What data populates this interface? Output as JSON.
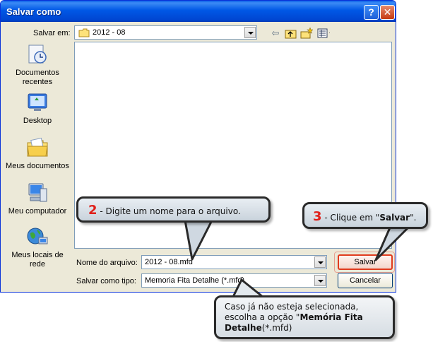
{
  "window": {
    "title": "Salvar como",
    "help_btn": "?",
    "close_btn": "✕"
  },
  "toolbar": {
    "save_in_label": "Salvar em:",
    "save_in_value": "2012 - 08",
    "icons": [
      "back-icon",
      "up-folder-icon",
      "new-folder-icon",
      "view-menu-icon"
    ]
  },
  "places": [
    {
      "label": "Documentos recentes",
      "icon": "recent-documents-icon"
    },
    {
      "label": "Desktop",
      "icon": "desktop-icon"
    },
    {
      "label": "Meus documentos",
      "icon": "my-documents-icon"
    },
    {
      "label": "Meu computador",
      "icon": "my-computer-icon"
    },
    {
      "label": "Meus locais de rede",
      "icon": "network-places-icon"
    }
  ],
  "form": {
    "filename_label": "Nome do arquivo:",
    "filename_value": "2012 - 08.mfd",
    "filetype_label": "Salvar como tipo:",
    "filetype_value": "Memoria Fita Detalhe (*.mfd)"
  },
  "buttons": {
    "save": "Salvar",
    "cancel": "Cancelar"
  },
  "callouts": {
    "c2_num": "2",
    "c2_text": " - Digite um nome para o arquivo.",
    "c3_num": "3",
    "c3_pre": " - Clique em \"",
    "c3_bold": "Salvar",
    "c3_post": "\".",
    "c4_pre": "Caso já não esteja selecionada, escolha a opção \"",
    "c4_bold": "Memória Fita Detalhe",
    "c4_post": "(*.mfd)"
  }
}
